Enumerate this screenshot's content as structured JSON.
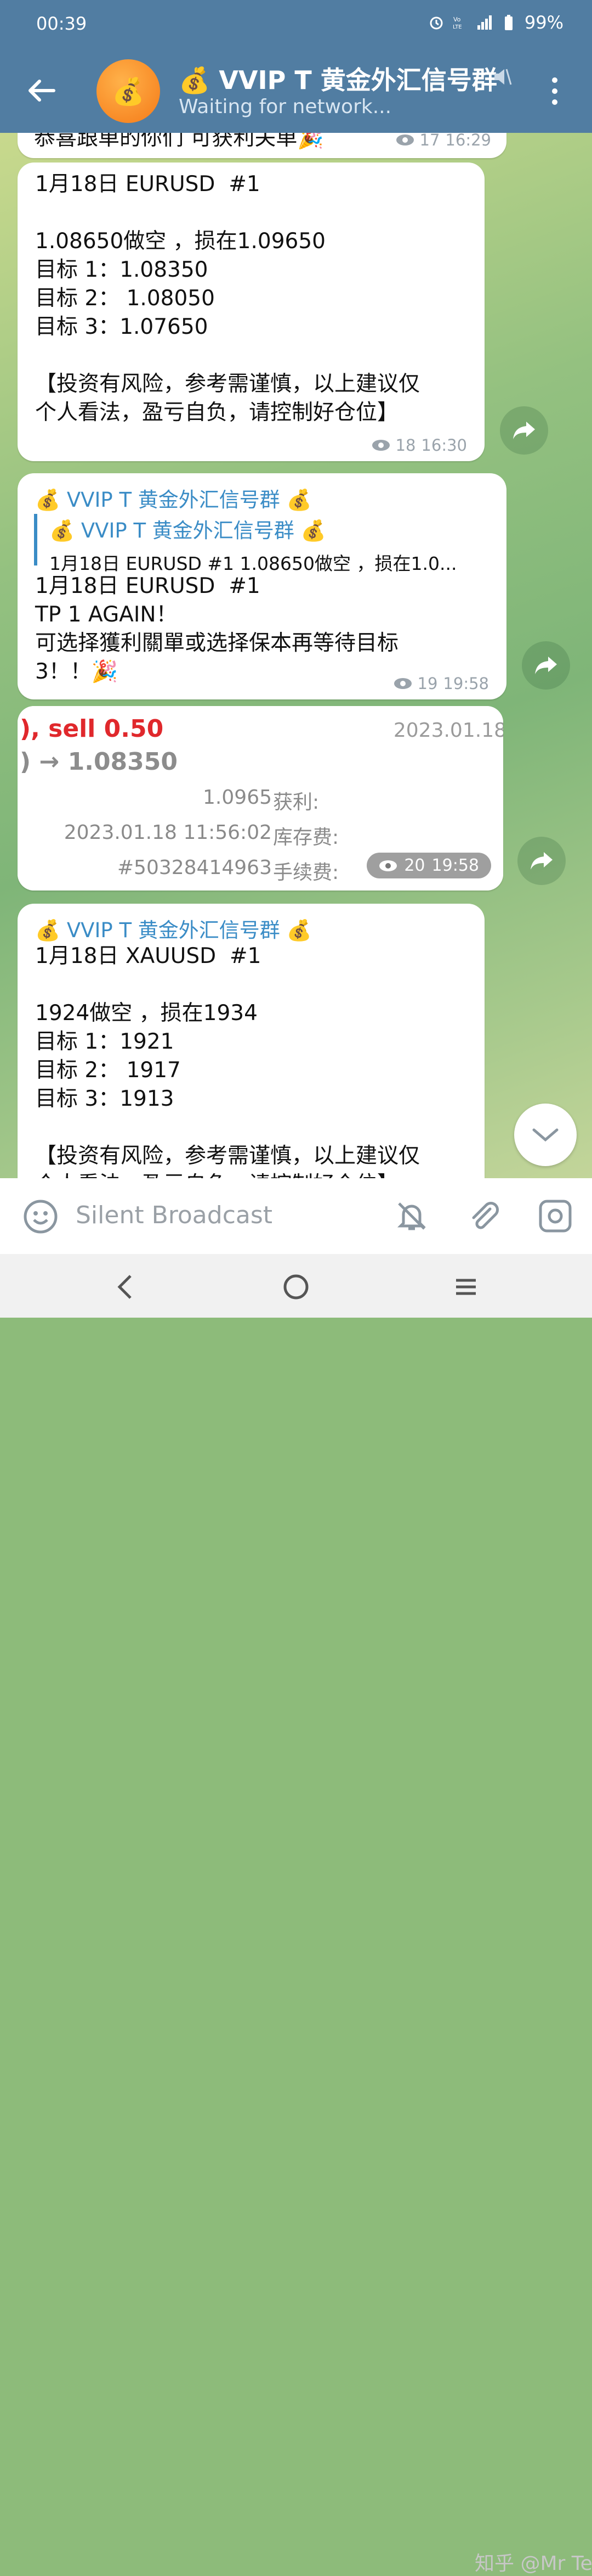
{
  "status_bar": {
    "time": "00:39",
    "battery": "99%"
  },
  "header": {
    "title": "💰 VVIP T 黄金外汇信号群",
    "subtitle": "Waiting for network...",
    "avatar_emoji": "💰"
  },
  "messages": [
    {
      "text": "恭喜跟单的你们 可获利关单🎉",
      "views": "17",
      "time": "16:29"
    },
    {
      "text": "1月18日 EURUSD  #1\n\n1.08650做空 ，损在1.09650\n目标 1：1.08350\n目标 2： 1.08050\n目标 3：1.07650\n\n【投资有风险，参考需谨慎，以上建议仅\n个人看法，盈亏自负，请控制好仓位】",
      "views": "18",
      "time": "16:30"
    },
    {
      "sender": "💰 VVIP T 黄金外汇信号群 💰",
      "quote_name": "💰 VVIP T 黄金外汇信号群 💰",
      "quote_text": "1月18日 EURUSD  #1  1.08650做空 ，损在1.0...",
      "text": "1月18日 EURUSD  #1\nTP 1 AGAIN！\n可选择獲利關單或选择保本再等待目标\n3！！🎉",
      "views": "19",
      "time": "19:58"
    },
    {
      "image": {
        "sell_text": "), sell 0.50",
        "arrow_text": ") → 1.08350",
        "date_text": "2023.01.18",
        "rows": [
          {
            "value": "1.0965",
            "label": "获利:"
          },
          {
            "value": "2023.01.18 11:56:02",
            "label": "库存费:"
          },
          {
            "value": "#50328414963",
            "label": "手续费:"
          }
        ]
      },
      "views": "20",
      "time": "19:58"
    },
    {
      "sender": "💰 VVIP T 黄金外汇信号群 💰",
      "text": "1月18日 XAUUSD  #1\n\n1924做空 ，损在1934\n目标 1：1921\n目标 2： 1917\n目标 3：1913\n\n【投资有风险，参考需谨慎，以上建议仅\n个人看法，盈亏自负，请控制好仓位】"
    }
  ],
  "input": {
    "placeholder": "Silent Broadcast"
  },
  "watermark": "知乎 @Mr Tee",
  "colors": {
    "header": "#517da2",
    "link": "#3a8cc6",
    "sell": "#e0282c"
  }
}
